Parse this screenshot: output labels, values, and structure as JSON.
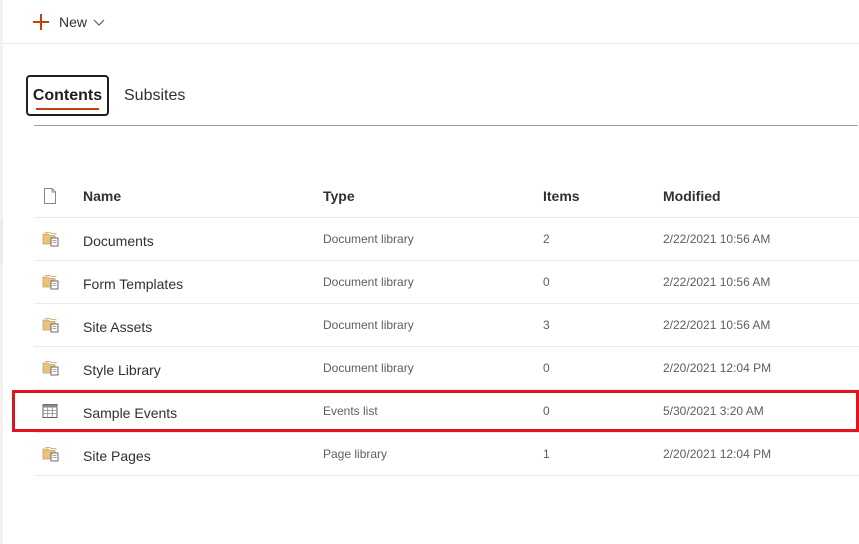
{
  "command_bar": {
    "new_label": "New"
  },
  "tabs": [
    {
      "label": "Contents",
      "selected": true
    },
    {
      "label": "Subsites",
      "selected": false
    }
  ],
  "table": {
    "columns": {
      "name": "Name",
      "type": "Type",
      "items": "Items",
      "modified": "Modified"
    },
    "rows": [
      {
        "icon": "document-library-icon",
        "name": "Documents",
        "type": "Document library",
        "items": "2",
        "modified": "2/22/2021 10:56 AM"
      },
      {
        "icon": "document-library-icon",
        "name": "Form Templates",
        "type": "Document library",
        "items": "0",
        "modified": "2/22/2021 10:56 AM"
      },
      {
        "icon": "document-library-icon",
        "name": "Site Assets",
        "type": "Document library",
        "items": "3",
        "modified": "2/22/2021 10:56 AM"
      },
      {
        "icon": "document-library-icon",
        "name": "Style Library",
        "type": "Document library",
        "items": "0",
        "modified": "2/20/2021 12:04 PM"
      },
      {
        "icon": "calendar-list-icon",
        "name": "Sample Events",
        "type": "Events list",
        "items": "0",
        "modified": "5/30/2021 3:20 AM",
        "highlighted": true
      },
      {
        "icon": "document-library-icon",
        "name": "Site Pages",
        "type": "Page library",
        "items": "1",
        "modified": "2/20/2021 12:04 PM"
      }
    ]
  },
  "colors": {
    "accent": "#c2410c",
    "highlight": "#e0141e",
    "folder": "#e8c37d"
  }
}
